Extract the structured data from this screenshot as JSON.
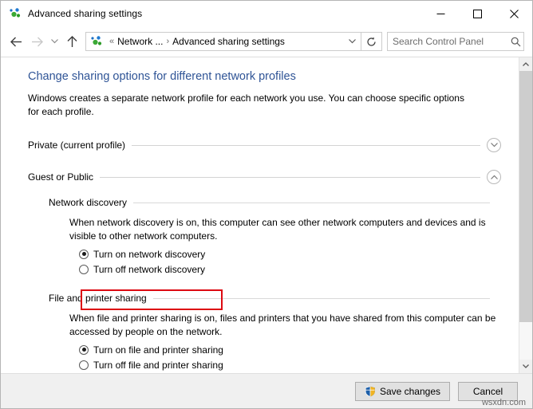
{
  "window": {
    "title": "Advanced sharing settings",
    "icon": "network-sharing-icon",
    "minimize": "—",
    "maximize": "☐",
    "close": "✕"
  },
  "addressbar": {
    "back": "←",
    "forward": "→",
    "recent": "⌵",
    "up": "↑",
    "crumb_overflow": "«",
    "crumb_1": "Network ...",
    "crumb_sep": "›",
    "crumb_2": "Advanced sharing settings",
    "dropdown": "⌵",
    "refresh": "↻",
    "search_placeholder": "Search Control Panel",
    "search_value": ""
  },
  "content": {
    "page_title": "Change sharing options for different network profiles",
    "page_desc": "Windows creates a separate network profile for each network you use. You can choose specific options for each profile.",
    "profiles": [
      {
        "label": "Private (current profile)",
        "expanded": false,
        "chevron": "∨"
      },
      {
        "label": "Guest or Public",
        "expanded": true,
        "chevron": "∧"
      }
    ],
    "sections": [
      {
        "title": "Network discovery",
        "description": "When network discovery is on, this computer can see other network computers and devices and is visible to other network computers.",
        "options": [
          {
            "label": "Turn on network discovery",
            "selected": true,
            "highlighted": true
          },
          {
            "label": "Turn off network discovery",
            "selected": false,
            "highlighted": false
          }
        ]
      },
      {
        "title": "File and printer sharing",
        "description": "When file and printer sharing is on, files and printers that you have shared from this computer can be accessed by people on the network.",
        "options": [
          {
            "label": "Turn on file and printer sharing",
            "selected": true,
            "highlighted": true
          },
          {
            "label": "Turn off file and printer sharing",
            "selected": false,
            "highlighted": false
          }
        ]
      }
    ]
  },
  "scrollbar": {
    "up_arrow": "∧",
    "down_arrow": "∨",
    "thumb_percent": 87
  },
  "buttonbar": {
    "save_label": "Save changes",
    "save_icon": "uac-shield-icon",
    "cancel_label": "Cancel"
  },
  "watermark": "wsxdn.com",
  "colors": {
    "accent_title": "#2f5496",
    "annotation_red": "#dd0a12",
    "chrome_gray": "#f0f0f0",
    "button_face": "#e1e1e1"
  }
}
